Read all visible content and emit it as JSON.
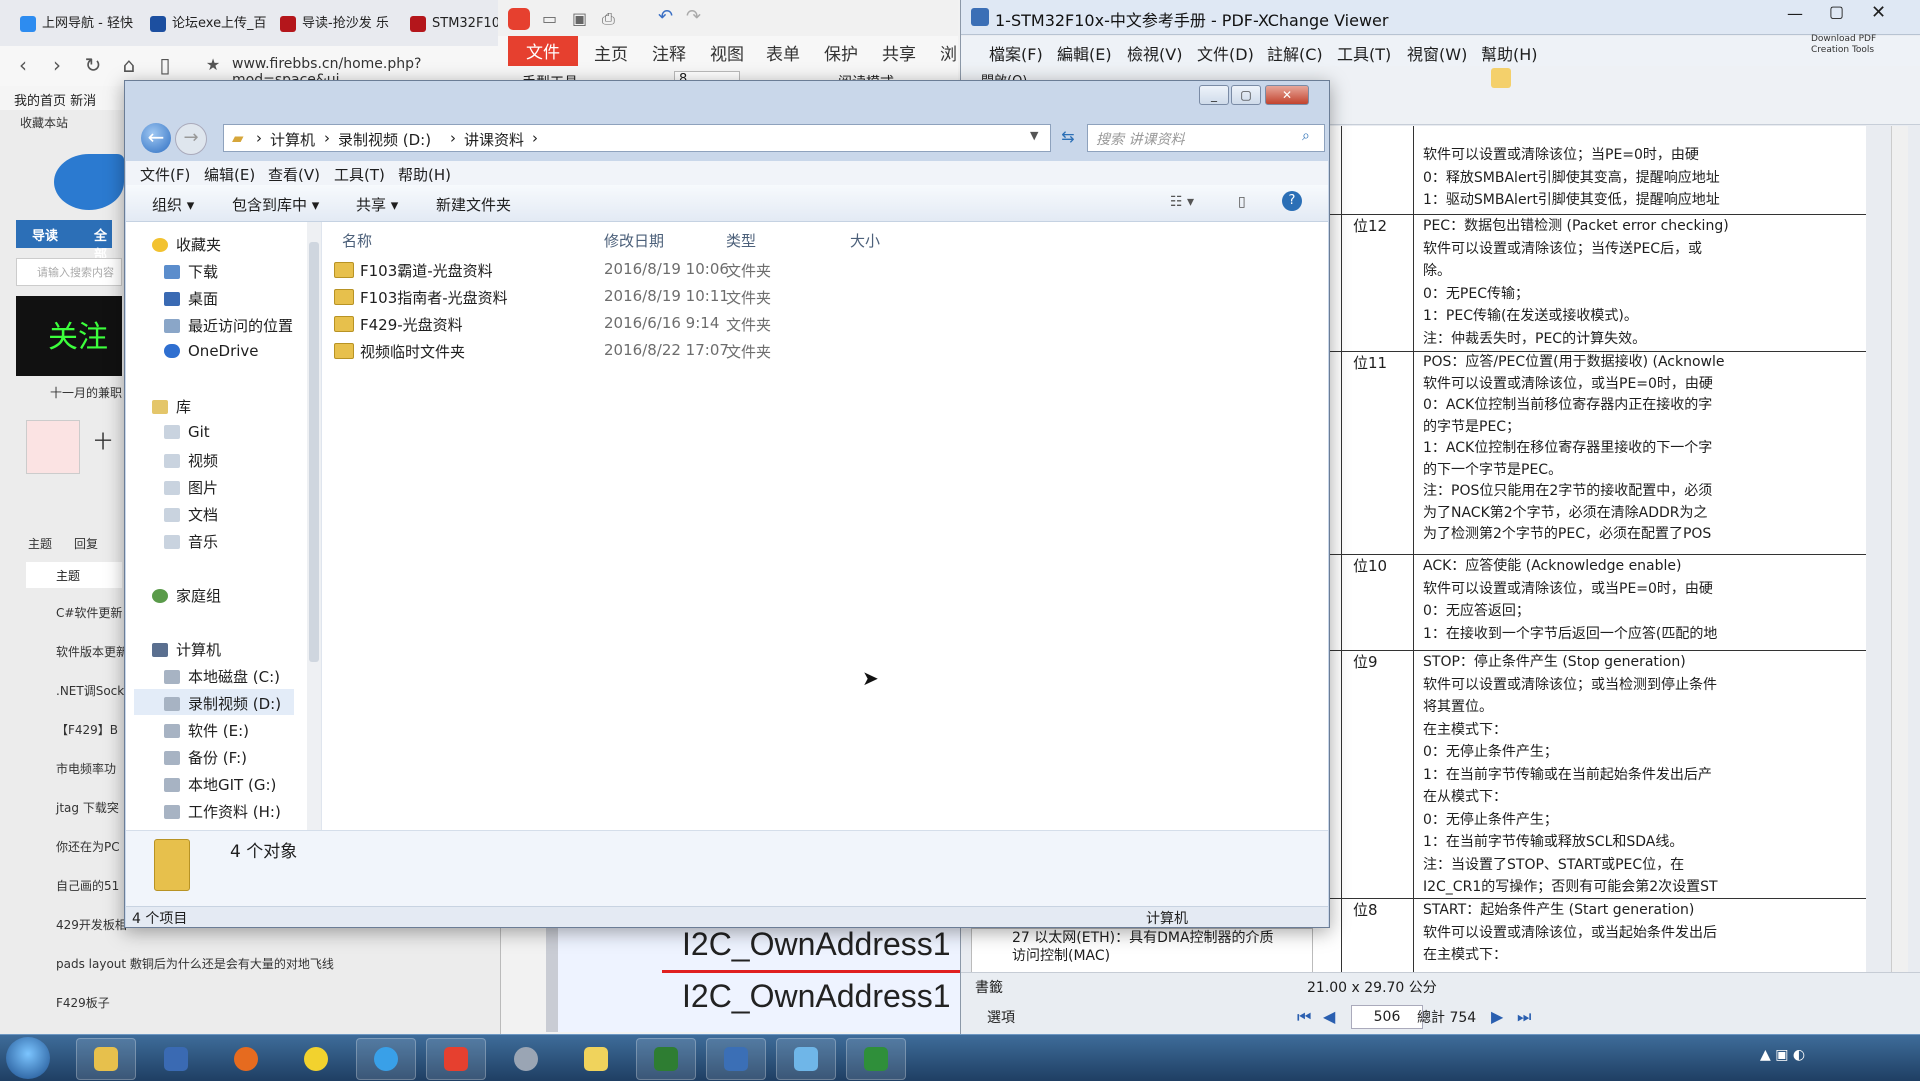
{
  "browser": {
    "tabs": [
      "上网导航 - 轻快",
      "论坛exe上传_百",
      "导读-抢沙发 乐",
      "STM32F10"
    ],
    "url": "www.firebbs.cn/home.php?mod=space&ui",
    "favorites_label": "收藏本站",
    "home_label": "我的首页 新消",
    "side_tabs": [
      "导读",
      "全部"
    ],
    "search_placeholder": "请输入搜索内容",
    "banner_text": "关注",
    "date_label": "十一月的兼职",
    "user_name": "十",
    "tab_labels": [
      "主题",
      "回复"
    ],
    "topic_header": "主题",
    "threads": [
      "C#软件更新",
      "软件版本更新",
      ".NET调Sock",
      "【F429】B",
      "市电频率功",
      "jtag 下载突",
      "你还在为PC",
      "自己画的51",
      "429开发板相",
      "pads layout 敷铜后为什么还是会有大量的对地飞线",
      "F429板子"
    ]
  },
  "wps": {
    "menu": [
      "文件",
      "主页",
      "注释",
      "视图",
      "表单",
      "保护",
      "共享",
      "浏"
    ],
    "active_menu": "文件",
    "page_input": "8",
    "reading_mode": "阅读模式",
    "hand_tool": "手型工具",
    "doc_text": "I2C_OwnAddress1",
    "doc_text2": "I2C_OwnAddress1"
  },
  "pdf": {
    "title": "1-STM32F10x-中文参考手册 - PDF-XChange Viewer",
    "menu": [
      "檔案(F)",
      "編輯(E)",
      "檢視(V)",
      "文件(D)",
      "註解(C)",
      "工具(T)",
      "視窗(W)",
      "幫助(H)"
    ],
    "download_label": "Download PDF Creation Tools",
    "open_label": "開啟(O)",
    "bookmark_item": "27 以太网(ETH)：具有DMA控制器的介质访问控制(MAC)",
    "bookmarks_label": "書籤",
    "options_label": "選項",
    "page_size": "21.00 x 29.70 公分",
    "current_page": "506",
    "total_pages": "總計 754",
    "rows": [
      {
        "bit": "",
        "lines": [
          "软件可以设置或清除该位；当PE=0时，由硬",
          "0：释放SMBAlert引脚使其变高，提醒响应地址",
          "1：驱动SMBAlert引脚使其变低，提醒响应地址"
        ]
      },
      {
        "bit": "位12",
        "lines": [
          "PEC：数据包出错检测 (Packet error checking)",
          "软件可以设置或清除该位；当传送PEC后，或",
          "除。",
          "0：无PEC传输；",
          "1：PEC传输(在发送或接收模式)。",
          "注：仲裁丢失时，PEC的计算失效。"
        ]
      },
      {
        "bit": "位11",
        "lines": [
          "POS：应答/PEC位置(用于数据接收) (Acknowle",
          "软件可以设置或清除该位，或当PE=0时，由硬",
          "0：ACK位控制当前移位寄存器内正在接收的字",
          "的字节是PEC；",
          "1：ACK位控制在移位寄存器里接收的下一个字",
          "的下一个字节是PEC。",
          "注：POS位只能用在2字节的接收配置中，必须",
          "为了NACK第2个字节，必须在清除ADDR为之",
          "为了检测第2个字节的PEC，必须在配置了POS"
        ]
      },
      {
        "bit": "位10",
        "lines": [
          "ACK：应答使能 (Acknowledge enable)",
          "软件可以设置或清除该位，或当PE=0时，由硬",
          "0：无应答返回；",
          "1：在接收到一个字节后返回一个应答(匹配的地"
        ]
      },
      {
        "bit": "位9",
        "lines": [
          "STOP：停止条件产生 (Stop generation)",
          "软件可以设置或清除该位；或当检测到停止条件",
          "将其置位。",
          "在主模式下：",
          "0：无停止条件产生；",
          "1：在当前字节传输或在当前起始条件发出后产",
          "在从模式下：",
          "0：无停止条件产生；",
          "1：在当前字节传输或释放SCL和SDA线。",
          "注：当设置了STOP、START或PEC位，在",
          "I2C_CR1的写操作；否则有可能会第2次设置ST"
        ]
      },
      {
        "bit": "位8",
        "lines": [
          "START：起始条件产生 (Start generation)",
          "软件可以设置或清除该位，或当起始条件发出后",
          "在主模式下："
        ]
      }
    ]
  },
  "explorer": {
    "path": [
      "计算机",
      "录制视频 (D:)",
      "讲课资料"
    ],
    "search_placeholder": "搜索 讲课资料",
    "menu": [
      "文件(F)",
      "编辑(E)",
      "查看(V)",
      "工具(T)",
      "帮助(H)"
    ],
    "commands": [
      "组织 ▾",
      "包含到库中 ▾",
      "共享 ▾",
      "新建文件夹"
    ],
    "nav": {
      "favorites": "收藏夹",
      "favorite_items": [
        "下载",
        "桌面",
        "最近访问的位置",
        "OneDrive"
      ],
      "libraries": "库",
      "library_items": [
        "Git",
        "视频",
        "图片",
        "文档",
        "音乐"
      ],
      "homegroup": "家庭组",
      "computer": "计算机",
      "drives": [
        "本地磁盘 (C:)",
        "录制视频 (D:)",
        "软件 (E:)",
        "备份 (F:)",
        "本地GIT (G:)",
        "工作资料 (H:)"
      ]
    },
    "columns": [
      "名称",
      "修改日期",
      "类型",
      "大小"
    ],
    "files": [
      {
        "name": "F103霸道-光盘资料",
        "date": "2016/8/19 10:06",
        "type": "文件夹"
      },
      {
        "name": "F103指南者-光盘资料",
        "date": "2016/8/19 10:11",
        "type": "文件夹"
      },
      {
        "name": "F429-光盘资料",
        "date": "2016/6/16 9:14",
        "type": "文件夹"
      },
      {
        "name": "视频临时文件夹",
        "date": "2016/8/22 17:07",
        "type": "文件夹"
      }
    ],
    "details_count": "4 个对象",
    "status_count": "4 个项目",
    "status_location": "计算机"
  },
  "colors": {
    "wps_red": "#e6402f",
    "explorer_frame": "#c9d7ea",
    "taskbar": "#1f3f63",
    "folder": "#e7c04c"
  }
}
